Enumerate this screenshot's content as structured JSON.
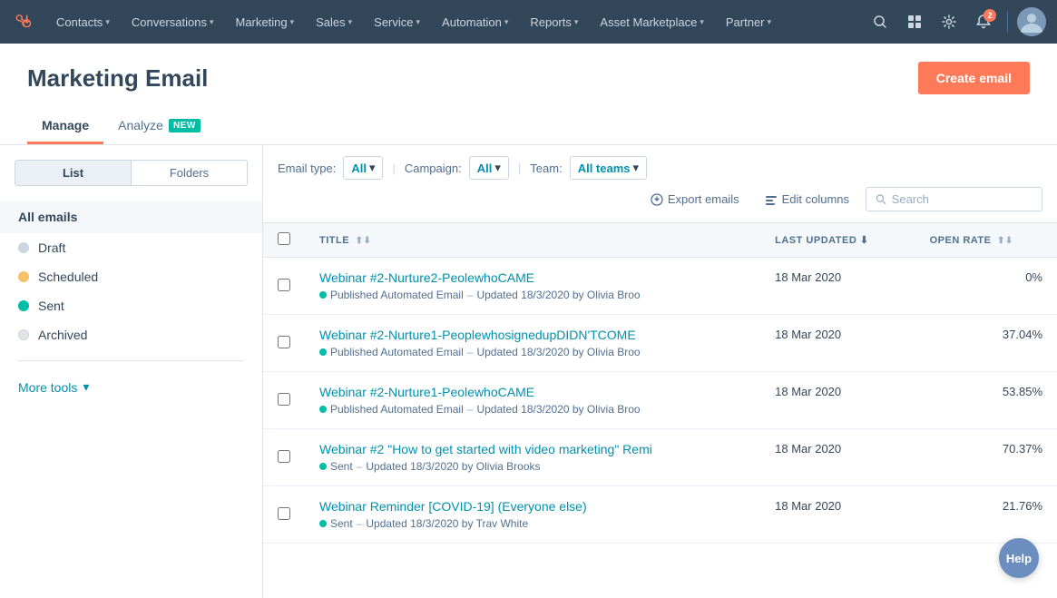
{
  "topnav": {
    "items": [
      {
        "label": "Contacts",
        "key": "contacts"
      },
      {
        "label": "Conversations",
        "key": "conversations"
      },
      {
        "label": "Marketing",
        "key": "marketing"
      },
      {
        "label": "Sales",
        "key": "sales"
      },
      {
        "label": "Service",
        "key": "service"
      },
      {
        "label": "Automation",
        "key": "automation"
      },
      {
        "label": "Reports",
        "key": "reports"
      },
      {
        "label": "Asset Marketplace",
        "key": "asset-marketplace"
      },
      {
        "label": "Partner",
        "key": "partner"
      }
    ],
    "notification_count": "2"
  },
  "page": {
    "title": "Marketing Email",
    "create_btn_label": "Create email"
  },
  "tabs": [
    {
      "label": "Manage",
      "active": true,
      "badge": null
    },
    {
      "label": "Analyze",
      "active": false,
      "badge": "NEW"
    }
  ],
  "sidebar": {
    "view_list_label": "List",
    "view_folders_label": "Folders",
    "all_emails_label": "All emails",
    "items": [
      {
        "label": "Draft",
        "dot_class": "dot-draft"
      },
      {
        "label": "Scheduled",
        "dot_class": "dot-scheduled"
      },
      {
        "label": "Sent",
        "dot_class": "dot-sent"
      },
      {
        "label": "Archived",
        "dot_class": "dot-archived"
      }
    ],
    "more_tools_label": "More tools"
  },
  "filters": {
    "email_type_label": "Email type:",
    "email_type_value": "All",
    "campaign_label": "Campaign:",
    "campaign_value": "All",
    "team_label": "Team:",
    "team_value": "All teams",
    "export_label": "Export emails",
    "edit_columns_label": "Edit columns",
    "search_placeholder": "Search"
  },
  "table": {
    "columns": [
      {
        "label": "TITLE",
        "sortable": true,
        "sort_active": false
      },
      {
        "label": "LAST UPDATED",
        "sortable": true,
        "sort_active": true
      },
      {
        "label": "OPEN RATE",
        "sortable": true,
        "sort_active": false
      }
    ],
    "rows": [
      {
        "title": "Webinar #2-Nurture2-PeolewhoCAME",
        "status": "Published Automated Email",
        "status_class": "status-published",
        "meta": "Updated 18/3/2020 by Olivia Broo",
        "last_updated": "18 Mar 2020",
        "open_rate": "0%"
      },
      {
        "title": "Webinar #2-Nurture1-PeoplewhosignedupDIDN'TCOME",
        "status": "Published Automated Email",
        "status_class": "status-published",
        "meta": "Updated 18/3/2020 by Olivia Broo",
        "last_updated": "18 Mar 2020",
        "open_rate": "37.04%"
      },
      {
        "title": "Webinar #2-Nurture1-PeolewhoCAME",
        "status": "Published Automated Email",
        "status_class": "status-published",
        "meta": "Updated 18/3/2020 by Olivia Broo",
        "last_updated": "18 Mar 2020",
        "open_rate": "53.85%"
      },
      {
        "title": "Webinar #2 \"How to get started with video marketing\" Remi",
        "status": "Sent",
        "status_class": "status-sent",
        "meta": "Updated 18/3/2020 by Olivia Brooks",
        "last_updated": "18 Mar 2020",
        "open_rate": "70.37%"
      },
      {
        "title": "Webinar Reminder [COVID-19] (Everyone else)",
        "status": "Sent",
        "status_class": "status-sent",
        "meta": "Updated 18/3/2020 by Trav White",
        "last_updated": "18 Mar 2020",
        "open_rate": "21.76%"
      }
    ]
  },
  "help": {
    "label": "Help"
  }
}
